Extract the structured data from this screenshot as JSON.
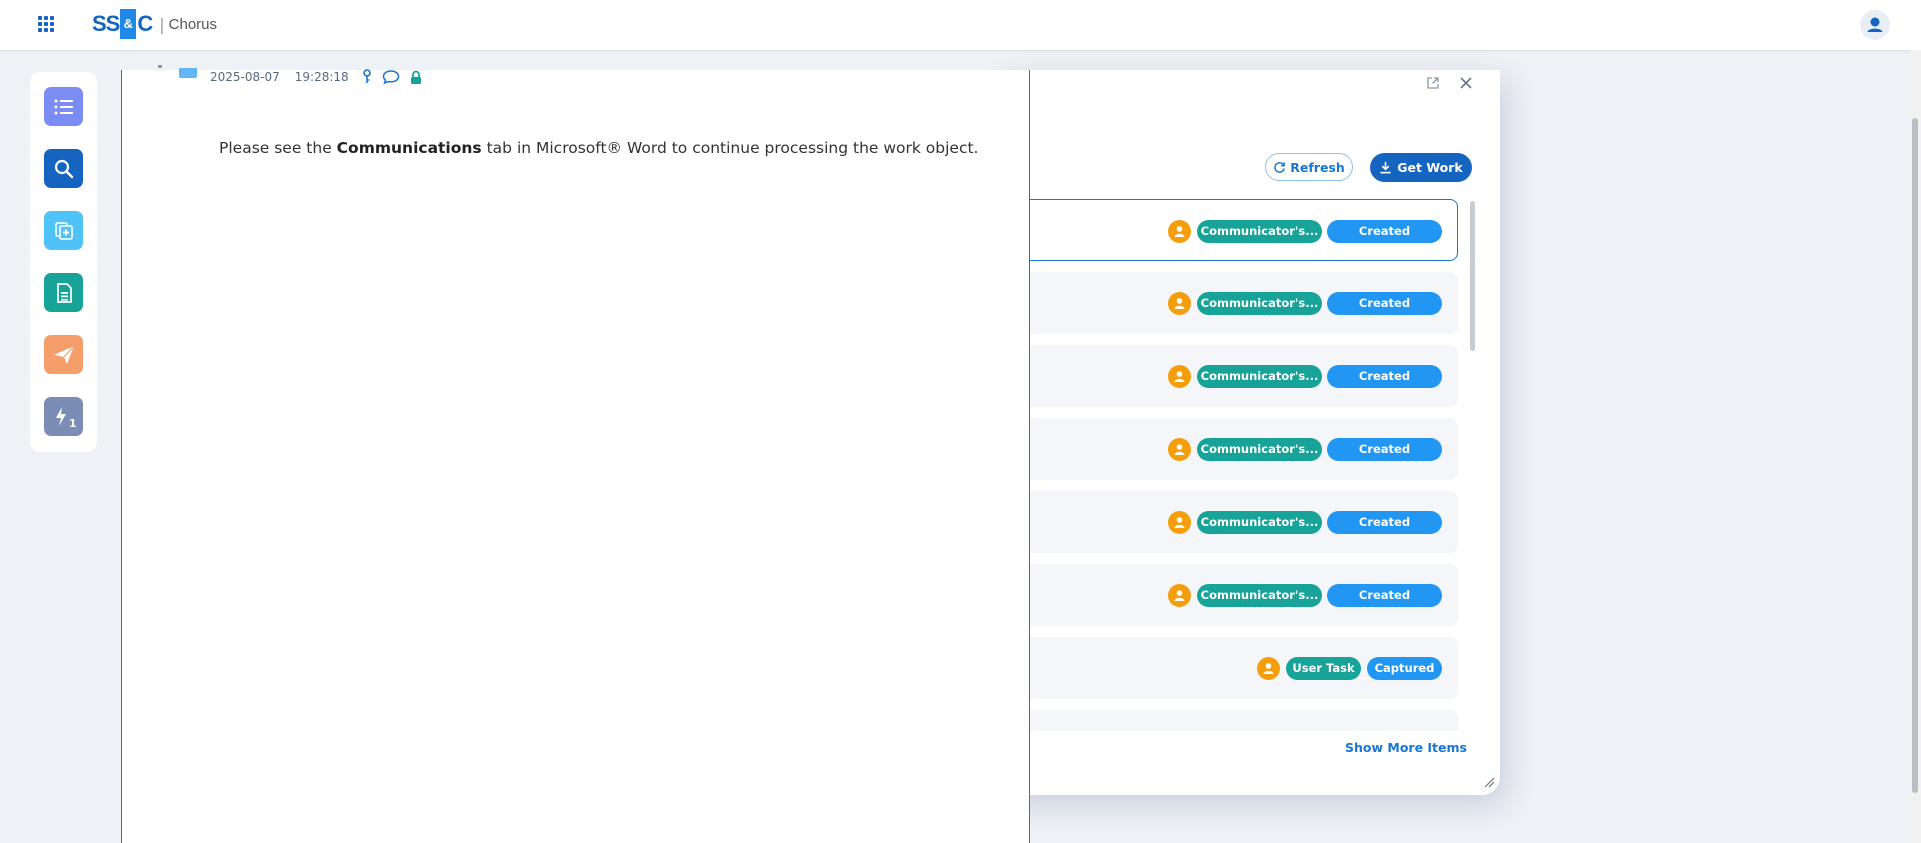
{
  "header": {
    "logo_ss": "SS",
    "logo_amp": "&",
    "logo_c": "C",
    "logo_sep": "|",
    "app_name": "Chorus"
  },
  "rail": {
    "items": [
      {
        "name": "worklist",
        "icon": "list-icon",
        "color": "#7b8cf5"
      },
      {
        "name": "search",
        "icon": "search-icon",
        "color": "#1565c0"
      },
      {
        "name": "create",
        "icon": "copy-plus-icon",
        "color": "#4fc3f7"
      },
      {
        "name": "forms",
        "icon": "document-icon",
        "color": "#17a398"
      },
      {
        "name": "send",
        "icon": "paper-plane-icon",
        "color": "#f59e6a"
      },
      {
        "name": "actions",
        "icon": "lightning-icon",
        "color": "#7b8db5",
        "badge": "1"
      }
    ]
  },
  "worklist": {
    "refresh_label": "Refresh",
    "getwork_label": "Get Work",
    "show_more_label": "Show More Items",
    "rows": [
      {
        "tag": "Communicator's...",
        "status": "Created",
        "selected": true
      },
      {
        "tag": "Communicator's...",
        "status": "Created",
        "selected": false
      },
      {
        "tag": "Communicator's...",
        "status": "Created",
        "selected": false
      },
      {
        "tag": "Communicator's...",
        "status": "Created",
        "selected": false
      },
      {
        "tag": "Communicator's...",
        "status": "Created",
        "selected": false
      },
      {
        "tag": "Communicator's...",
        "status": "Created",
        "selected": false
      },
      {
        "tag": "User Task",
        "status": "Captured",
        "selected": false
      }
    ]
  },
  "document": {
    "date": "2025-08-07",
    "time": "19:28:18",
    "message_before": "Please see the ",
    "message_bold": "Communications",
    "message_after": " tab in Microsoft® Word to continue processing the work object."
  },
  "colors": {
    "accent": "#1565c0",
    "teal_tag": "#17a398",
    "blue_tag": "#2196f3",
    "user_badge": "#f59e0b"
  }
}
